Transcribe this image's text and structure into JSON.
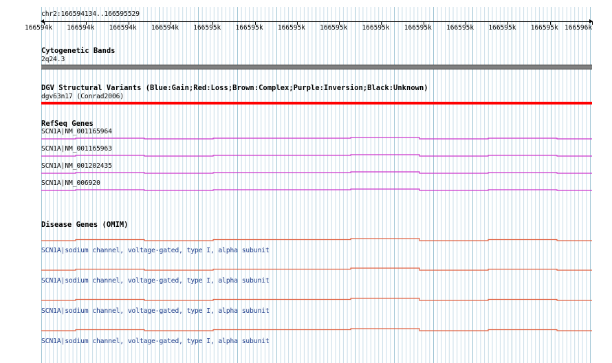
{
  "locus": "chr2:166594134..166595529",
  "ruler_ticks": [
    "166594k",
    "166594k",
    "166594k",
    "166594k",
    "166595k",
    "166595k",
    "166595k",
    "166595k",
    "166595k",
    "166595k",
    "166595k",
    "166595k",
    "166595k",
    "166596k"
  ],
  "cytogenetic": {
    "title": "Cytogenetic Bands",
    "band": "2q24.3",
    "color": "#808080"
  },
  "dgv": {
    "title": "DGV Structural Variants (Blue:Gain;Red:Loss;Brown:Complex;Purple:Inversion;Black:Unknown)",
    "variant": "dgv63n17 (Conrad2006)",
    "color": "#ff0000"
  },
  "refseq": {
    "title": "RefSeq Genes",
    "color": "#cc33cc",
    "genes": [
      "SCN1A|NM_001165964",
      "SCN1A|NM_001165963",
      "SCN1A|NM_001202435",
      "SCN1A|NM_006920"
    ]
  },
  "omim": {
    "title": "Disease Genes (OMIM)",
    "color": "#e06040",
    "genes": [
      "SCN1A|sodium channel, voltage-gated, type I, alpha subunit",
      "SCN1A|sodium channel, voltage-gated, type I, alpha subunit",
      "SCN1A|sodium channel, voltage-gated, type I, alpha subunit",
      "SCN1A|sodium channel, voltage-gated, type I, alpha subunit"
    ]
  },
  "colors": {
    "grid_minor": "#c8dde8",
    "grid_major": "#9ec4d4"
  }
}
